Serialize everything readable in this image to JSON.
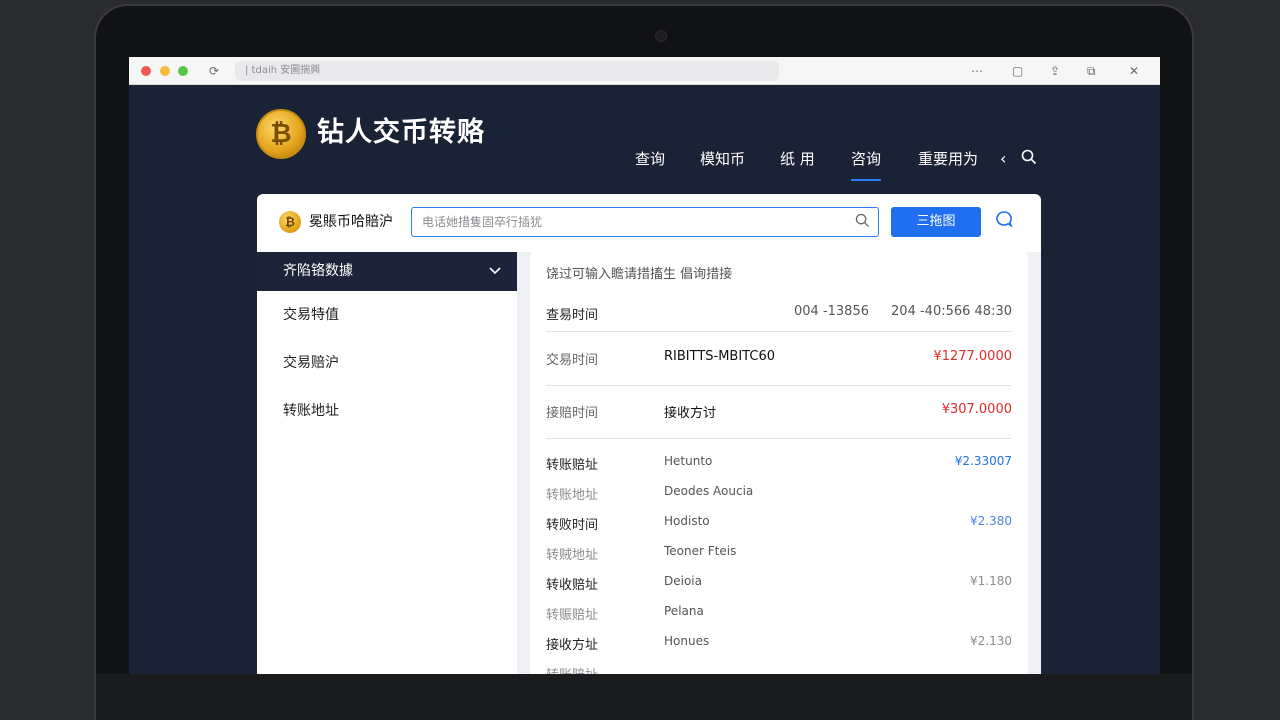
{
  "browser": {
    "url": "| tdaih 安圖揣興",
    "icons": [
      "refresh-icon",
      "more-icon",
      "window-icon",
      "share-icon",
      "extension-icon",
      "close-icon"
    ]
  },
  "site": {
    "logo_glyph": "₿",
    "title": "钻人交币转赂",
    "nav": [
      {
        "label": "查询",
        "active": false
      },
      {
        "label": "模知币",
        "active": false
      },
      {
        "label": "纸 用",
        "active": false
      },
      {
        "label": "咨询",
        "active": true
      },
      {
        "label": "重要用为",
        "active": false
      }
    ],
    "nav_chevron": "‹"
  },
  "card": {
    "logo_glyph": "₿",
    "title": "冕賬币哈賠沪",
    "search_placeholder": "电话她措隻固卒行插犹",
    "primary_button": "三拖图",
    "sidebar": {
      "header": "齐陷铬数據",
      "items": [
        "交易特值",
        "交易赔沪",
        "转账地址"
      ]
    },
    "panel": {
      "hint": "饶过可输入瞻请措搐生 倡询措接",
      "header_row": {
        "label": "查易时间",
        "mid": "004 -13856",
        "right": "204 -40:566  48:30"
      },
      "big_rows": [
        {
          "label": "交易时间",
          "mid": "RIBITTS-MBITC60",
          "amount": "¥1277.0000"
        },
        {
          "label": "接赔时间",
          "mid": "接收方讨",
          "amount": "¥307.0000"
        }
      ],
      "list_rows": [
        {
          "label": "转账赔址",
          "muted": false,
          "name": "Hetunto",
          "amount": "¥2.33007",
          "color": "#1f6ff0"
        },
        {
          "label": "转账地址",
          "muted": true,
          "name": "Deodes Aoucia",
          "amount": "",
          "color": "#8a8c90"
        },
        {
          "label": "转败时间",
          "muted": false,
          "name": "Hodisto",
          "amount": "¥2.380",
          "color": "#4d86e0"
        },
        {
          "label": "转贼地址",
          "muted": true,
          "name": "Teoner Ftеis",
          "amount": "",
          "color": "#8a8c90"
        },
        {
          "label": "转收赔址",
          "muted": false,
          "name": "Deioia",
          "amount": "¥1.180",
          "color": "#8a8c90"
        },
        {
          "label": "转赈赔址",
          "muted": true,
          "name": "Pelana",
          "amount": "",
          "color": "#8a8c90"
        },
        {
          "label": "接收方址",
          "muted": false,
          "name": "Honues",
          "amount": "¥2.130",
          "color": "#8a8c90"
        },
        {
          "label": "转账赔址",
          "muted": true,
          "name": "",
          "amount": "",
          "color": "#8a8c90"
        }
      ]
    }
  }
}
